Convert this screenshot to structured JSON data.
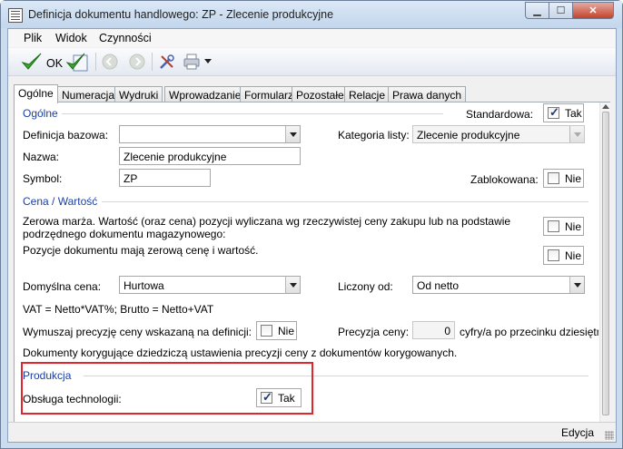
{
  "window": {
    "title": "Definicja dokumentu handlowego: ZP - Zlecenie produkcyjne"
  },
  "menu": {
    "items": [
      "Plik",
      "Widok",
      "Czynności"
    ]
  },
  "toolbar": {
    "ok_label": "OK"
  },
  "tabs": [
    "Ogólne",
    "Numeracja",
    "Wydruki",
    "Wprowadzanie",
    "Formularz",
    "Pozostałe",
    "Relacje",
    "Prawa danych"
  ],
  "general": {
    "section_title": "Ogólne",
    "standard_label": "Standardowa:",
    "standard_value": "Tak",
    "base_def_label": "Definicja bazowa:",
    "base_def_value": "",
    "category_label": "Kategoria listy:",
    "category_value": "Zlecenie produkcyjne",
    "name_label": "Nazwa:",
    "name_value": "Zlecenie produkcyjne",
    "symbol_label": "Symbol:",
    "symbol_value": "ZP",
    "blocked_label": "Zablokowana:",
    "blocked_value": "Nie"
  },
  "price": {
    "section_title": "Cena / Wartość",
    "zero_margin_text": "Zerowa marża. Wartość (oraz cena) pozycji wyliczana wg rzeczywistej ceny zakupu lub na podstawie podrzędnego dokumentu magazynowego:",
    "zero_margin_value": "Nie",
    "zero_price_text": "Pozycje dokumentu mają zerową cenę i wartość.",
    "zero_price_value": "Nie",
    "default_price_label": "Domyślna cena:",
    "default_price_value": "Hurtowa",
    "calc_from_label": "Liczony od:",
    "calc_from_value": "Od netto",
    "vat_formula": "VAT = Netto*VAT%; Brutto = Netto+VAT",
    "force_precision_label": "Wymuszaj precyzję ceny wskazaną na definicji:",
    "force_precision_value": "Nie",
    "precision_label": "Precyzja ceny:",
    "precision_value": "0",
    "precision_suffix": "cyfry/a po przecinku dziesiętnym",
    "correction_text": "Dokumenty korygujące dziedziczą ustawienia precyzji ceny z dokumentów korygowanych."
  },
  "production": {
    "section_title": "Produkcja",
    "technology_label": "Obsługa technologii:",
    "technology_value": "Tak"
  },
  "status": {
    "text": "Edycja"
  },
  "colors": {
    "section_title": "#1a3fa0",
    "highlight": "#e0262c",
    "ok_green": "#3aa52c"
  }
}
